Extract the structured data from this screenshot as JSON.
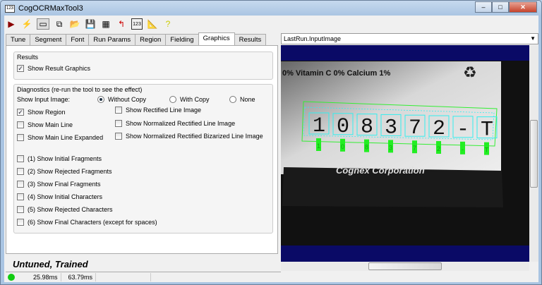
{
  "window": {
    "title": "CogOCRMaxTool3",
    "app_icon": "123"
  },
  "toolbar": [
    "run-icon",
    "reset-icon",
    "show-view-icon",
    "floating-icon",
    "open-icon",
    "save-icon",
    "import-icon",
    "send-icon",
    "image-icon",
    "ruler-icon",
    "help-icon"
  ],
  "tabs": [
    {
      "label": "Tune"
    },
    {
      "label": "Segment"
    },
    {
      "label": "Font"
    },
    {
      "label": "Run Params"
    },
    {
      "label": "Region"
    },
    {
      "label": "Fielding"
    },
    {
      "label": "Graphics",
      "active": true
    },
    {
      "label": "Results"
    }
  ],
  "results_group": {
    "title": "Results",
    "show_result_graphics": {
      "label": "Show Result Graphics",
      "checked": true
    }
  },
  "diagnostics": {
    "title": "Diagnostics (re-run the tool to see the effect)",
    "show_input_image_label": "Show Input Image:",
    "radios": [
      {
        "label": "Without Copy",
        "selected": true
      },
      {
        "label": "With Copy",
        "selected": false
      },
      {
        "label": "None",
        "selected": false
      }
    ],
    "left_checks": [
      {
        "label": "Show Region",
        "checked": true
      },
      {
        "label": "Show Main Line",
        "checked": false
      },
      {
        "label": "Show Main Line Expanded",
        "checked": false
      }
    ],
    "right_checks": [
      {
        "label": "Show Rectified Line Image",
        "checked": false
      },
      {
        "label": "Show Normalized Rectified Line Image",
        "checked": false
      },
      {
        "label": "Show Normalized Rectified Bizarized Line Image",
        "checked": false
      }
    ],
    "numbered_checks": [
      {
        "label": "(1) Show Initial Fragments",
        "checked": false
      },
      {
        "label": "(2) Show Rejected Fragments",
        "checked": false
      },
      {
        "label": "(3) Show Final Fragments",
        "checked": false
      },
      {
        "label": "(4) Show Initial Characters",
        "checked": false
      },
      {
        "label": "(5) Show Rejected Characters",
        "checked": false
      },
      {
        "label": "(6) Show Final Characters (except for spaces)",
        "checked": false
      }
    ]
  },
  "state_text": "Untuned, Trained",
  "status": {
    "indicator_color": "#22cc22",
    "time1": "25.98ms",
    "time2": "63.79ms"
  },
  "image_view": {
    "selected": "LastRun.InputImage",
    "label_text": "0%  Vitamin C 0%  Calcium 1%",
    "read_string": "108372-T",
    "chars": [
      "1",
      "0",
      "8",
      "3",
      "7",
      "2",
      "-",
      "T"
    ],
    "footer": "Cognex Corporation"
  }
}
